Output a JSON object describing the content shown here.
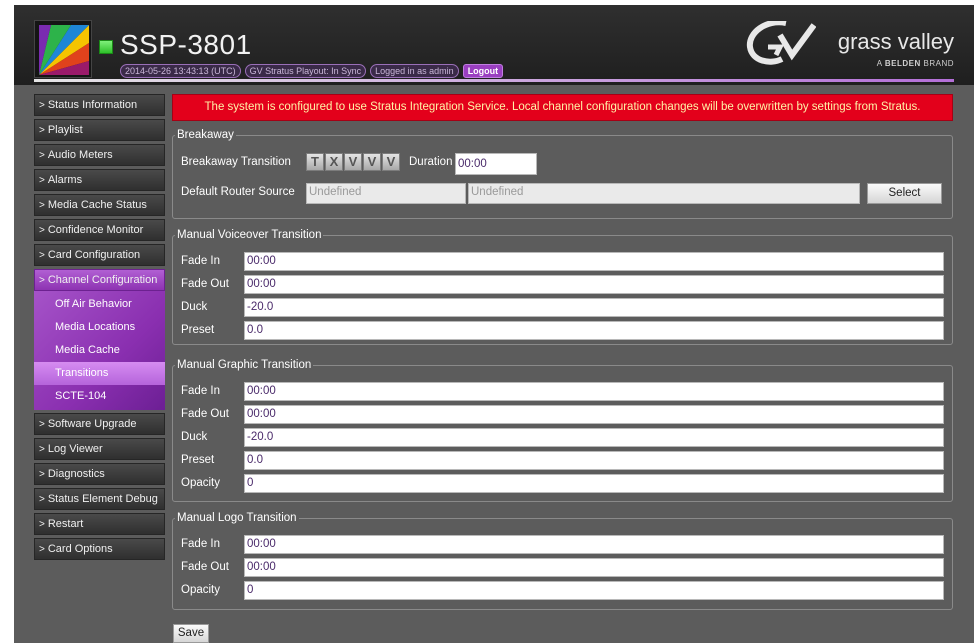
{
  "header": {
    "product": "SSP-3801",
    "timestamp": "2014-05-26 13:43:13 (UTC)",
    "sync_status": "GV Stratus Playout: In Sync",
    "login_status": "Logged in as admin",
    "logout_label": "Logout",
    "brand_name": "grass valley",
    "brand_sub_prefix": "A ",
    "brand_sub_bold": "BELDEN",
    "brand_sub_suffix": " BRAND"
  },
  "sidebar": {
    "items": [
      {
        "label": "Status Information"
      },
      {
        "label": "Playlist"
      },
      {
        "label": "Audio Meters"
      },
      {
        "label": "Alarms"
      },
      {
        "label": "Media Cache Status"
      },
      {
        "label": "Confidence Monitor"
      },
      {
        "label": "Card Configuration"
      },
      {
        "label": "Channel Configuration"
      },
      {
        "label": "Software Upgrade"
      },
      {
        "label": "Log Viewer"
      },
      {
        "label": "Diagnostics"
      },
      {
        "label": "Status Element Debug"
      },
      {
        "label": "Restart"
      },
      {
        "label": "Card Options"
      }
    ],
    "subitems": [
      {
        "label": "Off Air Behavior"
      },
      {
        "label": "Media Locations"
      },
      {
        "label": "Media Cache"
      },
      {
        "label": "Transitions"
      },
      {
        "label": "SCTE-104"
      }
    ],
    "chevron": ">"
  },
  "banner": "The system is configured to use Stratus Integration Service. Local channel configuration changes will be overwritten by settings from Stratus.",
  "breakaway": {
    "legend": "Breakaway",
    "transition_label": "Breakaway Transition",
    "transition_buttons": [
      "T",
      "X",
      "V",
      "V",
      "V"
    ],
    "duration_label": "Duration",
    "duration_value": "00:00",
    "router_label": "Default Router Source",
    "router_value_1": "Undefined",
    "router_value_2": "Undefined",
    "select_label": "Select"
  },
  "voiceover": {
    "legend": "Manual Voiceover Transition",
    "fade_in_label": "Fade In",
    "fade_in": "00:00",
    "fade_out_label": "Fade Out",
    "fade_out": "00:00",
    "duck_label": "Duck",
    "duck": "-20.0",
    "preset_label": "Preset",
    "preset": "0.0"
  },
  "graphic": {
    "legend": "Manual Graphic Transition",
    "fade_in_label": "Fade In",
    "fade_in": "00:00",
    "fade_out_label": "Fade Out",
    "fade_out": "00:00",
    "duck_label": "Duck",
    "duck": "-20.0",
    "preset_label": "Preset",
    "preset": "0.0",
    "opacity_label": "Opacity",
    "opacity": "0"
  },
  "logo": {
    "legend": "Manual Logo Transition",
    "fade_in_label": "Fade In",
    "fade_in": "00:00",
    "fade_out_label": "Fade Out",
    "fade_out": "00:00",
    "opacity_label": "Opacity",
    "opacity": "0"
  },
  "save_label": "Save",
  "colors": {
    "accent": "#9a3fc0",
    "banner_bg": "#e3001b",
    "banner_text": "#fff3a8",
    "status_led": "#2fc02a"
  }
}
